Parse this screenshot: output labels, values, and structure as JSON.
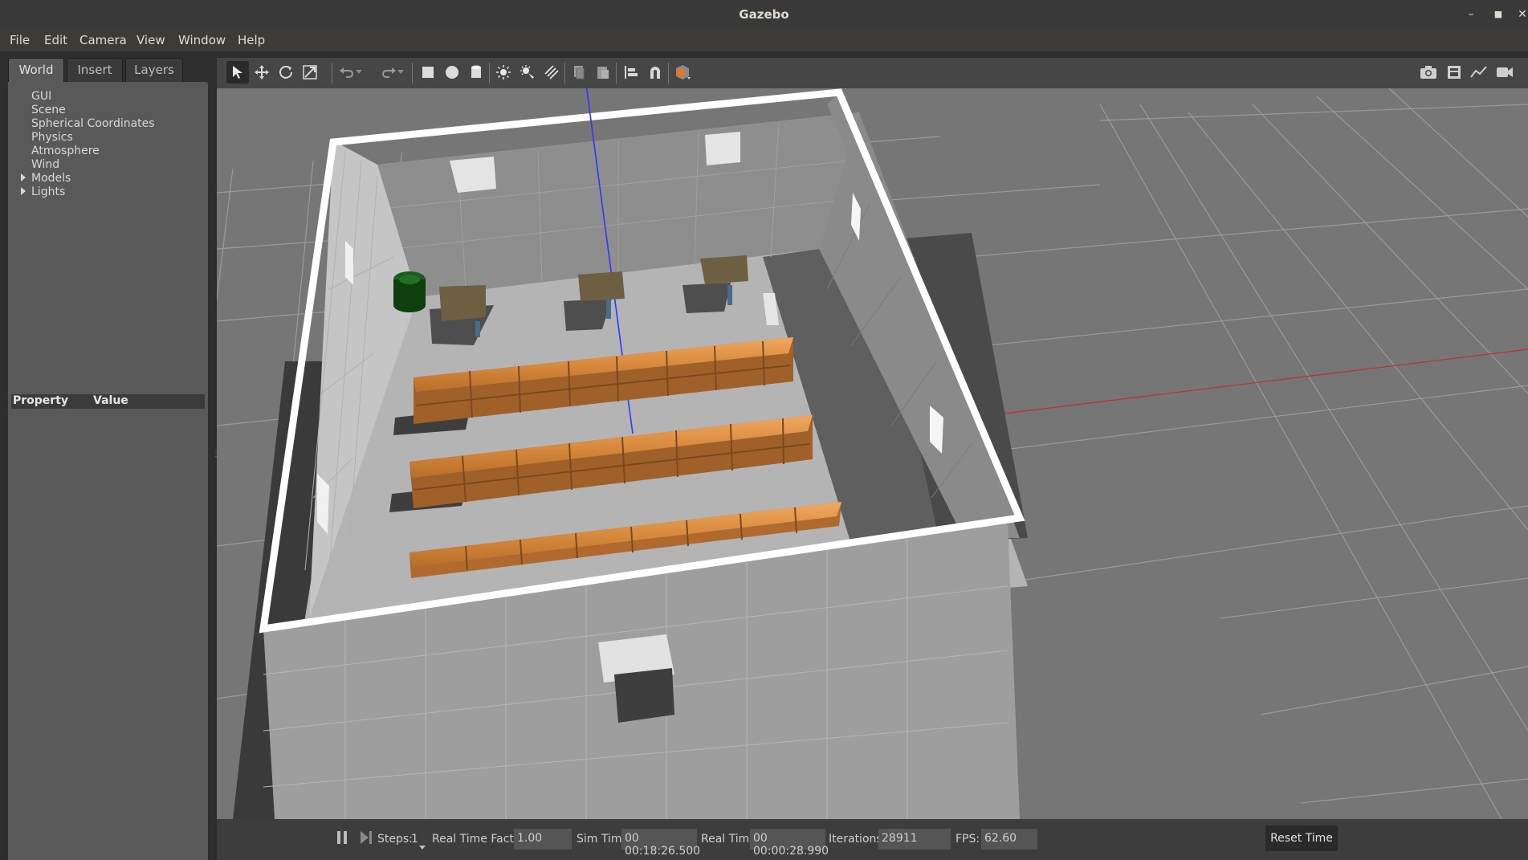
{
  "window": {
    "title": "Gazebo"
  },
  "menu": {
    "items": [
      "File",
      "Edit",
      "Camera",
      "View",
      "Window",
      "Help"
    ]
  },
  "left_panel": {
    "tabs": [
      "World",
      "Insert",
      "Layers"
    ],
    "active_tab": "World",
    "tree": [
      "GUI",
      "Scene",
      "Spherical Coordinates",
      "Physics",
      "Atmosphere",
      "Wind",
      "Models",
      "Lights"
    ],
    "property_header": {
      "property": "Property",
      "value": "Value"
    }
  },
  "toolbar": {
    "tools": [
      "select-mode",
      "translate-mode",
      "rotate-mode",
      "scale-mode",
      "undo",
      "redo",
      "box",
      "sphere",
      "cylinder",
      "point-light",
      "spot-light",
      "directional-light",
      "copy",
      "paste",
      "align",
      "snap",
      "change-view"
    ],
    "right_tools": [
      "screenshot",
      "log",
      "plot",
      "record-video"
    ]
  },
  "bottom": {
    "steps_label": "Steps:",
    "steps_value": "1",
    "rtf_label": "Real Time Factor:",
    "rtf_value": "1.00",
    "sim_label": "Sim Time:",
    "sim_value": "00 00:18:26.500",
    "real_label": "Real Time:",
    "real_value": "00 00:00:28.990",
    "iter_label": "Iterations:",
    "iter_value": "28911",
    "fps_label": "FPS:",
    "fps_value": "62.60",
    "reset_label": "Reset Time"
  },
  "colors": {
    "ground": "#767676",
    "wall_top": "#ffffff",
    "wall_face": "#a9a9a9",
    "floor": "#b3b3b3",
    "shelf": "#d98a40",
    "table": "#6b5a3a",
    "bin": "#1f6b1f"
  }
}
